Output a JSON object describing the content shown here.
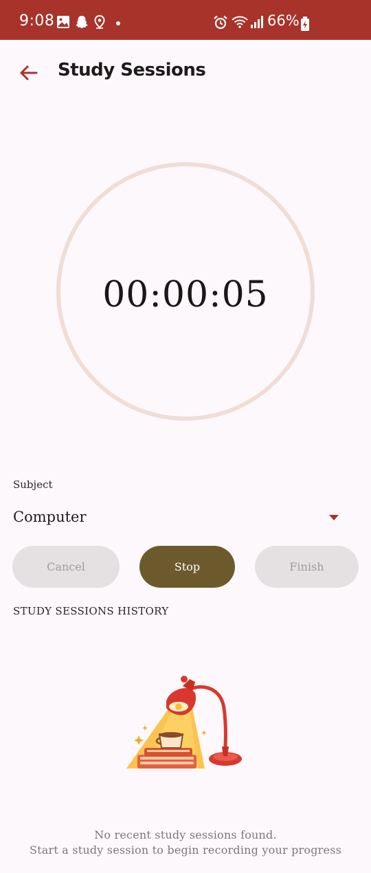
{
  "status_bar": {
    "time": "9:08",
    "battery": "66%",
    "left_icons": [
      "gallery-icon",
      "snapchat-icon",
      "location-icon",
      "dot-icon"
    ],
    "right_icons": [
      "alarm-icon",
      "wifi-icon",
      "signal-icon",
      "battery-icon"
    ]
  },
  "app_bar": {
    "title": "Study Sessions",
    "back_icon": "arrow-left-icon"
  },
  "timer": {
    "display": "00:00:05"
  },
  "subject": {
    "label": "Subject",
    "value": "Computer"
  },
  "actions": {
    "cancel_label": "Cancel",
    "stop_label": "Stop",
    "finish_label": "Finish"
  },
  "history": {
    "title": "STUDY SESSIONS HISTORY",
    "empty_line1": "No recent study sessions found.",
    "empty_line2": "Start a study session to begin recording your progress"
  },
  "colors": {
    "status_bar": "#a8332b",
    "accent": "#a8332b",
    "stop_button": "#6d5a2c",
    "disabled_button": "#e5e1e3",
    "ring": "#f0ddd6",
    "background": "#fdf8fb"
  }
}
